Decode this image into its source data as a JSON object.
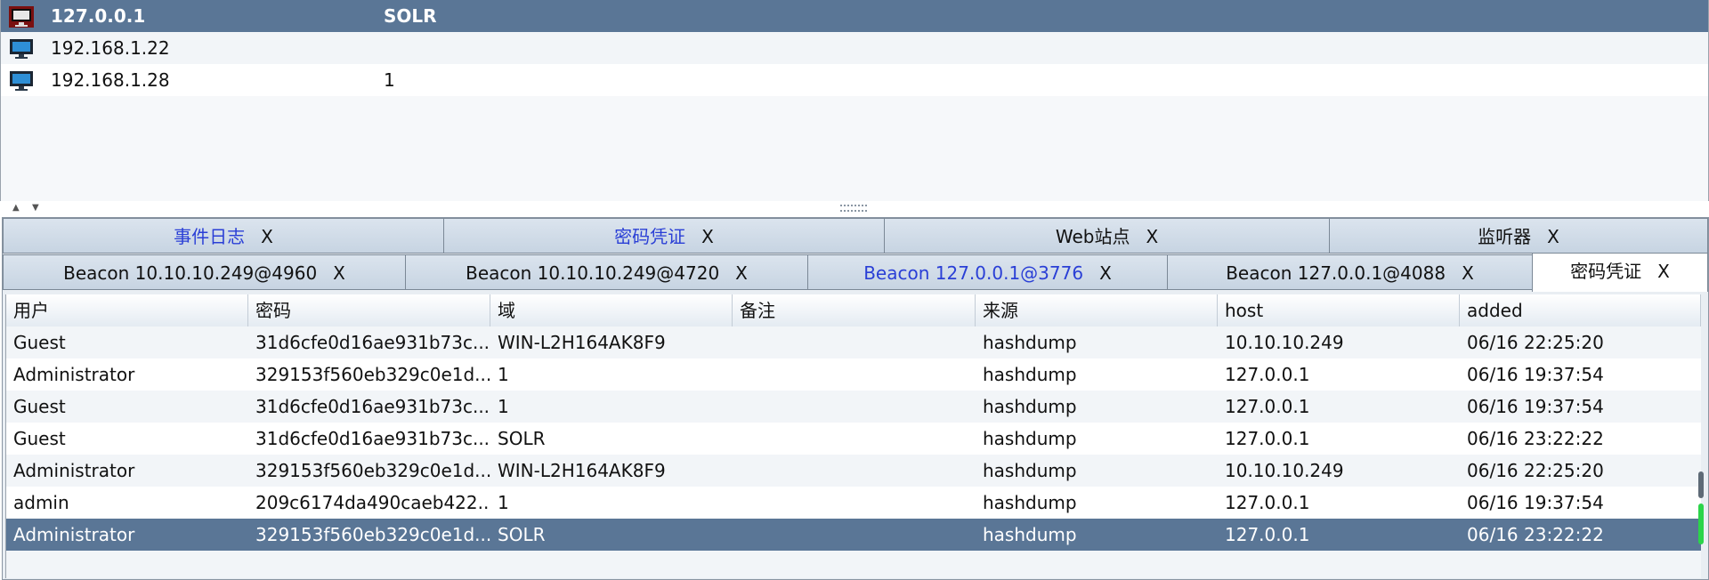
{
  "hosts": [
    {
      "ip": "127.0.0.1",
      "note": "SOLR",
      "icon": "monitor-alert-icon"
    },
    {
      "ip": "192.168.1.22",
      "note": "",
      "icon": "monitor-icon"
    },
    {
      "ip": "192.168.1.28",
      "note": "1",
      "icon": "monitor-icon"
    }
  ],
  "tabs_row1": [
    {
      "label": "事件日志",
      "close": "X"
    },
    {
      "label": "密码凭证",
      "close": "X"
    },
    {
      "label": "Web站点",
      "close": "X"
    },
    {
      "label": "监听器",
      "close": "X"
    }
  ],
  "tabs_row2": [
    {
      "label": "Beacon 10.10.10.249@4960",
      "close": "X"
    },
    {
      "label": "Beacon 10.10.10.249@4720",
      "close": "X"
    },
    {
      "label": "Beacon 127.0.0.1@3776",
      "close": "X"
    },
    {
      "label": "Beacon 127.0.0.1@4088",
      "close": "X"
    },
    {
      "label": "密码凭证",
      "close": "X"
    }
  ],
  "table": {
    "columns": [
      "用户",
      "密码",
      "域",
      "备注",
      "来源",
      "host",
      "added"
    ],
    "rows": [
      [
        "Guest",
        "31d6cfe0d16ae931b73c...",
        "WIN-L2H164AK8F9",
        "",
        "hashdump",
        "10.10.10.249",
        "06/16 22:25:20"
      ],
      [
        "Administrator",
        "329153f560eb329c0e1d...",
        "1",
        "",
        "hashdump",
        "127.0.0.1",
        "06/16 19:37:54"
      ],
      [
        "Guest",
        "31d6cfe0d16ae931b73c...",
        "1",
        "",
        "hashdump",
        "127.0.0.1",
        "06/16 19:37:54"
      ],
      [
        "Guest",
        "31d6cfe0d16ae931b73c...",
        "SOLR",
        "",
        "hashdump",
        "127.0.0.1",
        "06/16 23:22:22"
      ],
      [
        "Administrator",
        "329153f560eb329c0e1d...",
        "WIN-L2H164AK8F9",
        "",
        "hashdump",
        "10.10.10.249",
        "06/16 22:25:20"
      ],
      [
        "admin",
        "209c6174da490caeb422...",
        "1",
        "",
        "hashdump",
        "127.0.0.1",
        "06/16 19:37:54"
      ],
      [
        "Administrator",
        "329153f560eb329c0e1d...",
        "SOLR",
        "",
        "hashdump",
        "127.0.0.1",
        "06/16 23:22:22"
      ]
    ]
  },
  "colors": {
    "selection": "#5a7696",
    "tab_link": "#2a3fd6",
    "scroll_thumb": "#2bd44a"
  }
}
